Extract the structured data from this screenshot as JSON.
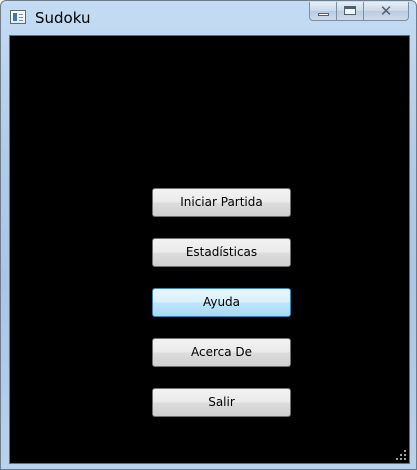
{
  "window": {
    "title": "Sudoku",
    "icon": "app-window-icon"
  },
  "caption_buttons": {
    "minimize_icon": "minimize-icon",
    "maximize_icon": "maximize-icon",
    "close_icon": "close-icon",
    "close_glyph": "✕"
  },
  "menu": {
    "items": [
      {
        "label": "Iniciar Partida"
      },
      {
        "label": "Estadísticas"
      },
      {
        "label": "Ayuda"
      },
      {
        "label": "Acerca De"
      },
      {
        "label": "Salir"
      }
    ],
    "hovered_item": "Ayuda"
  },
  "colors": {
    "client_background": "#000000",
    "button_hover": "#bee6fd"
  }
}
